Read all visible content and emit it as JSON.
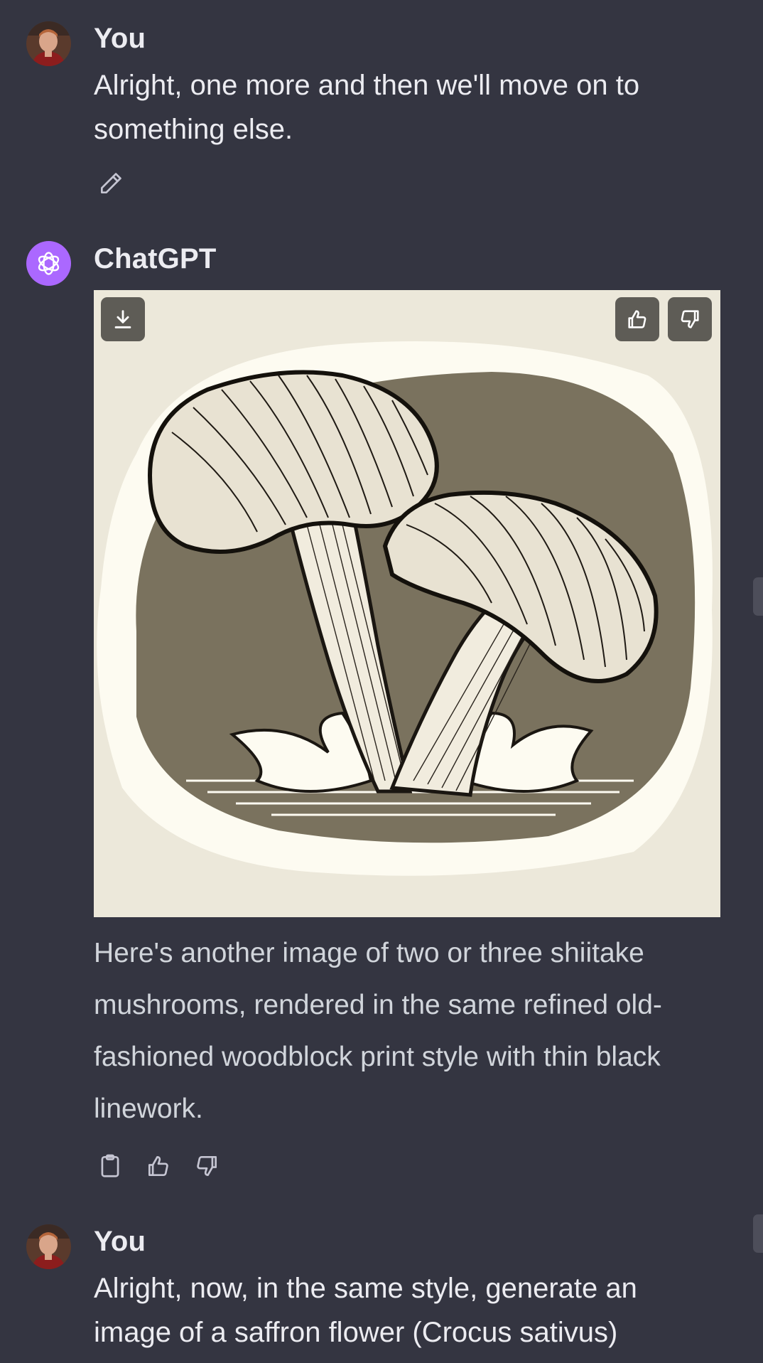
{
  "messages": [
    {
      "author": "You",
      "text": "Alright, one more and then we'll move on to something else.",
      "avatar": "user-avatar"
    },
    {
      "author": "ChatGPT",
      "avatar": "chatgpt-logo",
      "text": "Here's another image of two or three shiitake mushrooms, rendered in the same refined old-fashioned woodblock print style with thin black linework.",
      "image": {
        "description_icon": "generated-image",
        "buttons": [
          "download-icon",
          "thumbs-up-icon",
          "thumbs-down-icon"
        ]
      },
      "actions": [
        "copy-icon",
        "thumbs-up-icon",
        "thumbs-down-icon"
      ]
    },
    {
      "author": "You",
      "text": "Alright, now, in the same style, generate an image of a saffron flower (Crocus sativus)",
      "avatar": "user-avatar"
    }
  ],
  "colors": {
    "background": "#343541",
    "chatgpt_avatar": "#ab68ff",
    "image_bg": "#ece8da",
    "image_button": "#5e5c56"
  }
}
